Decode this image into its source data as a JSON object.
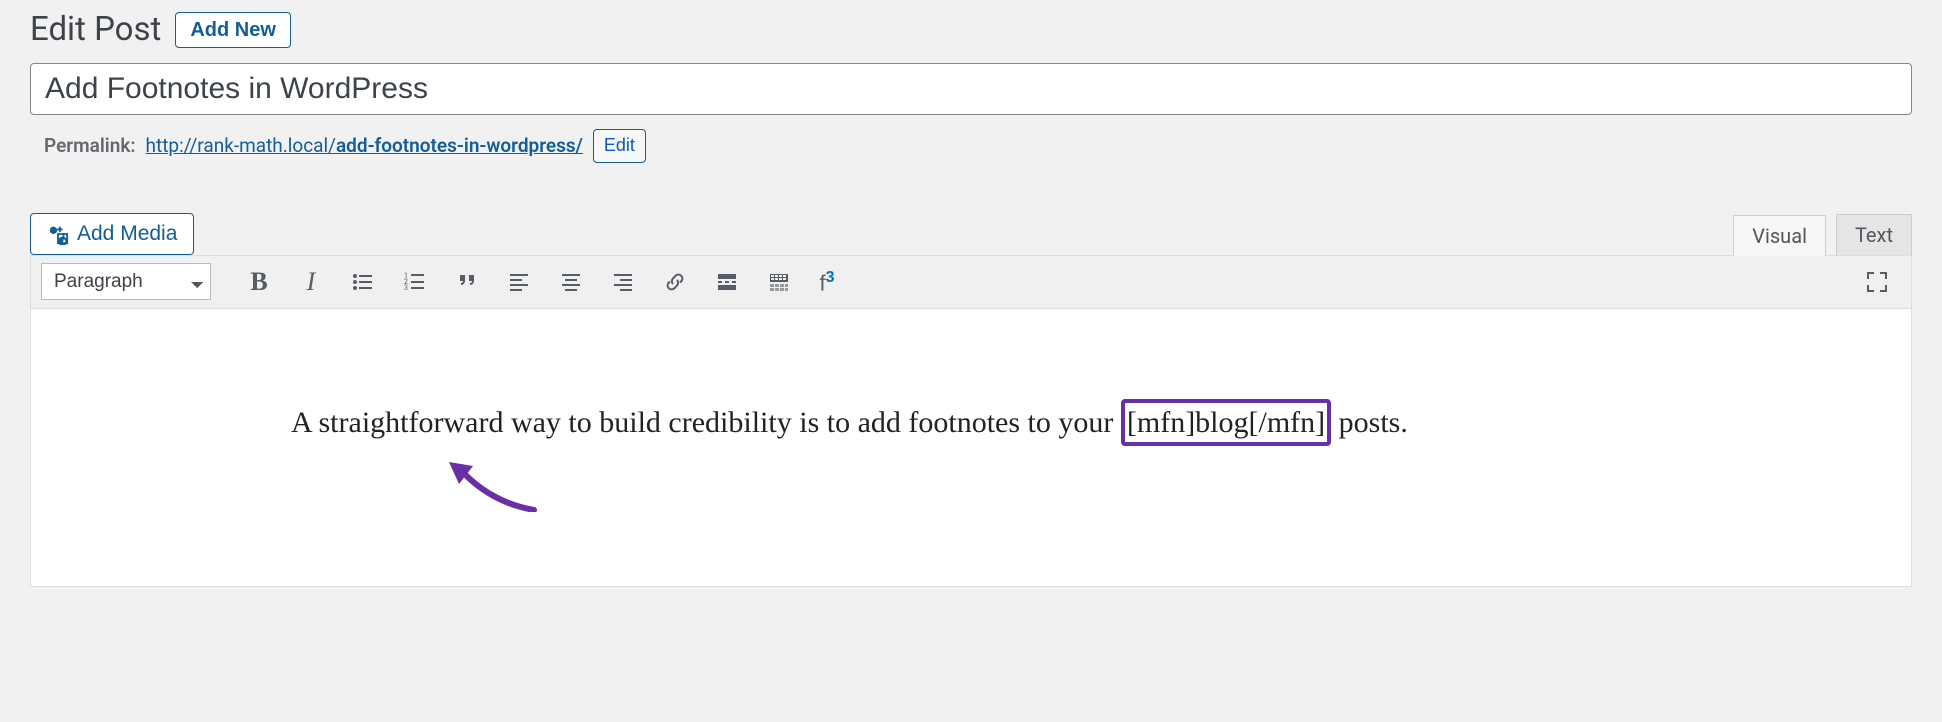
{
  "header": {
    "page_title": "Edit Post",
    "add_new": "Add New"
  },
  "post": {
    "title_value": "Add Footnotes in WordPress"
  },
  "permalink": {
    "label": "Permalink:",
    "base": "http://rank-math.local/",
    "slug": "add-footnotes-in-wordpress/",
    "edit_label": "Edit"
  },
  "media": {
    "add_media": "Add Media"
  },
  "tabs": {
    "visual": "Visual",
    "text": "Text"
  },
  "toolbar": {
    "format_label": "Paragraph",
    "bold": "B",
    "italic": "I",
    "blockquote": "““",
    "footnote_sup": "3"
  },
  "content": {
    "part1": "A straightforward way to build credibility is to add footnotes to your ",
    "highlighted": "[mfn]blog[/mfn]",
    "part2": " posts."
  }
}
